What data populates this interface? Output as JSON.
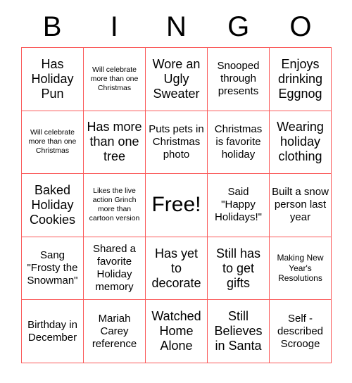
{
  "card": {
    "title_letters": [
      "B",
      "I",
      "N",
      "G",
      "O"
    ],
    "border_color": "#fa5a5a",
    "text_color": "#000000",
    "background_color": "#ffffff",
    "columns": 5,
    "rows": 5,
    "free_space_label": "Free!",
    "free_space_index": 12,
    "cells": [
      {
        "text": "Has Holiday Pun",
        "size": "lg"
      },
      {
        "text": "Will celebrate more than one Christmas",
        "size": "xs"
      },
      {
        "text": "Wore an Ugly Sweater",
        "size": "lg"
      },
      {
        "text": "Snooped through presents",
        "size": "md"
      },
      {
        "text": "Enjoys drinking Eggnog",
        "size": "lg"
      },
      {
        "text": "Will celebrate more than one Christmas",
        "size": "xs"
      },
      {
        "text": "Has more than one tree",
        "size": "lg"
      },
      {
        "text": "Puts pets in Christmas photo",
        "size": "md"
      },
      {
        "text": "Christmas is favorite holiday",
        "size": "md"
      },
      {
        "text": "Wearing holiday clothing",
        "size": "lg"
      },
      {
        "text": "Baked Holiday Cookies",
        "size": "lg"
      },
      {
        "text": "Likes the live action Grinch more than cartoon version",
        "size": "xs"
      },
      {
        "text": "Free!",
        "size": "free"
      },
      {
        "text": "Said \"Happy Holidays!\"",
        "size": "md"
      },
      {
        "text": "Built a snow person last year",
        "size": "md"
      },
      {
        "text": "Sang \"Frosty the Snowman\"",
        "size": "md"
      },
      {
        "text": "Shared a favorite Holiday memory",
        "size": "md"
      },
      {
        "text": "Has yet to decorate",
        "size": "lg"
      },
      {
        "text": "Still has to get gifts",
        "size": "lg"
      },
      {
        "text": "Making New Year's Resolutions",
        "size": "sm"
      },
      {
        "text": "Birthday in December",
        "size": "md"
      },
      {
        "text": "Mariah Carey reference",
        "size": "md"
      },
      {
        "text": "Watched Home Alone",
        "size": "lg"
      },
      {
        "text": "Still Believes in Santa",
        "size": "lg"
      },
      {
        "text": "Self - described Scrooge",
        "size": "md"
      }
    ]
  }
}
